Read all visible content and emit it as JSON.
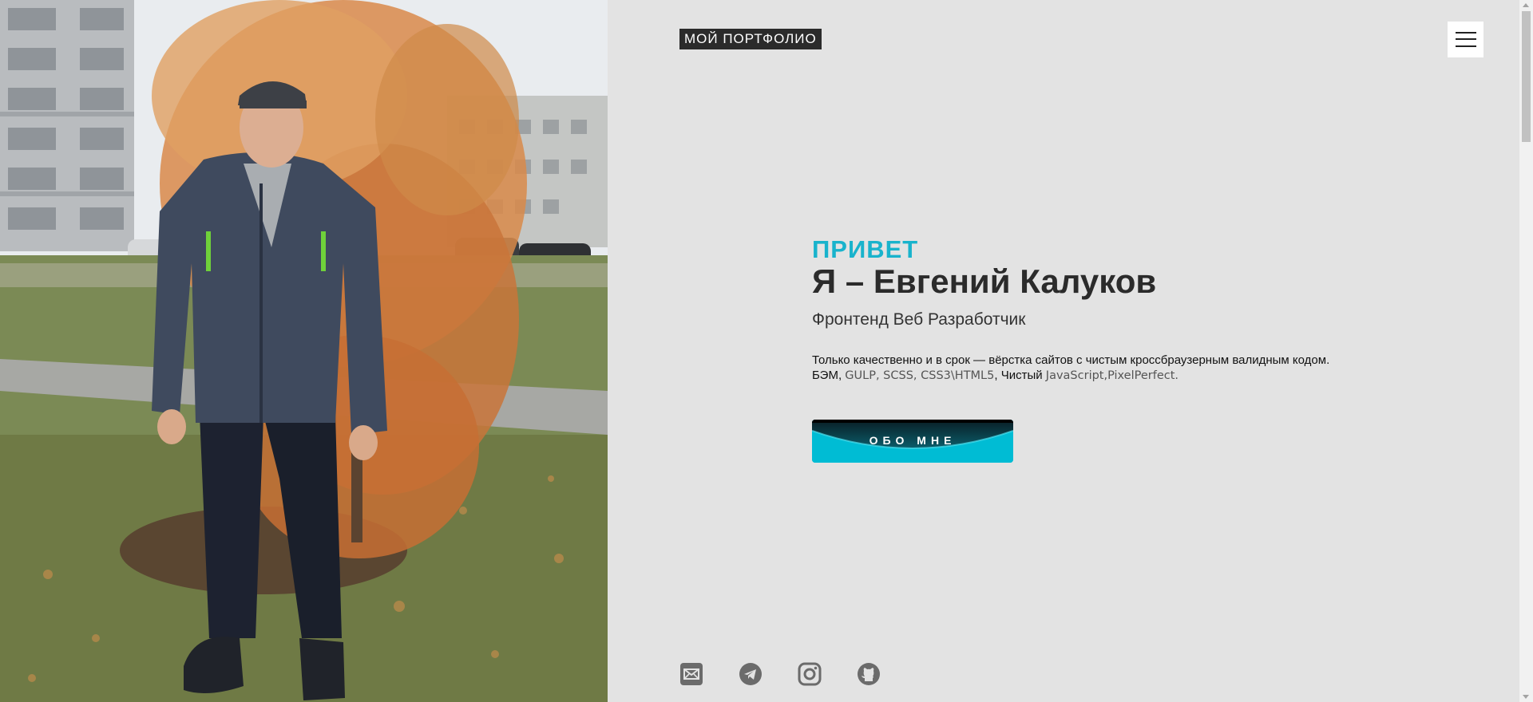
{
  "header": {
    "logo_text": "МОЙ ПОРТФОЛИО",
    "menu_icon": "hamburger-menu-icon"
  },
  "hero": {
    "greeting": "ПРИВЕТ",
    "name": "Я – Евгений Калуков",
    "role": "Фронтенд Веб Разработчик",
    "desc_part1": "Только качественно и в срок — вёрстка сайтов с чистым кроссбраузерным валидным кодом. БЭМ, ",
    "desc_tech1": "GULP, SCSS, CSS3\\HTML5",
    "desc_part2": ", Чистый ",
    "desc_tech2": "JavaScript,PixelPerfect.",
    "about_button": "ОБО МНЕ"
  },
  "socials": [
    {
      "name": "email",
      "icon": "mail-icon"
    },
    {
      "name": "telegram",
      "icon": "telegram-icon"
    },
    {
      "name": "instagram",
      "icon": "instagram-icon"
    },
    {
      "name": "github",
      "icon": "github-icon"
    }
  ],
  "colors": {
    "background": "#e3e3e3",
    "accent": "#19b3cc",
    "text": "#2b2b2b",
    "icon": "#6b6b6b"
  }
}
